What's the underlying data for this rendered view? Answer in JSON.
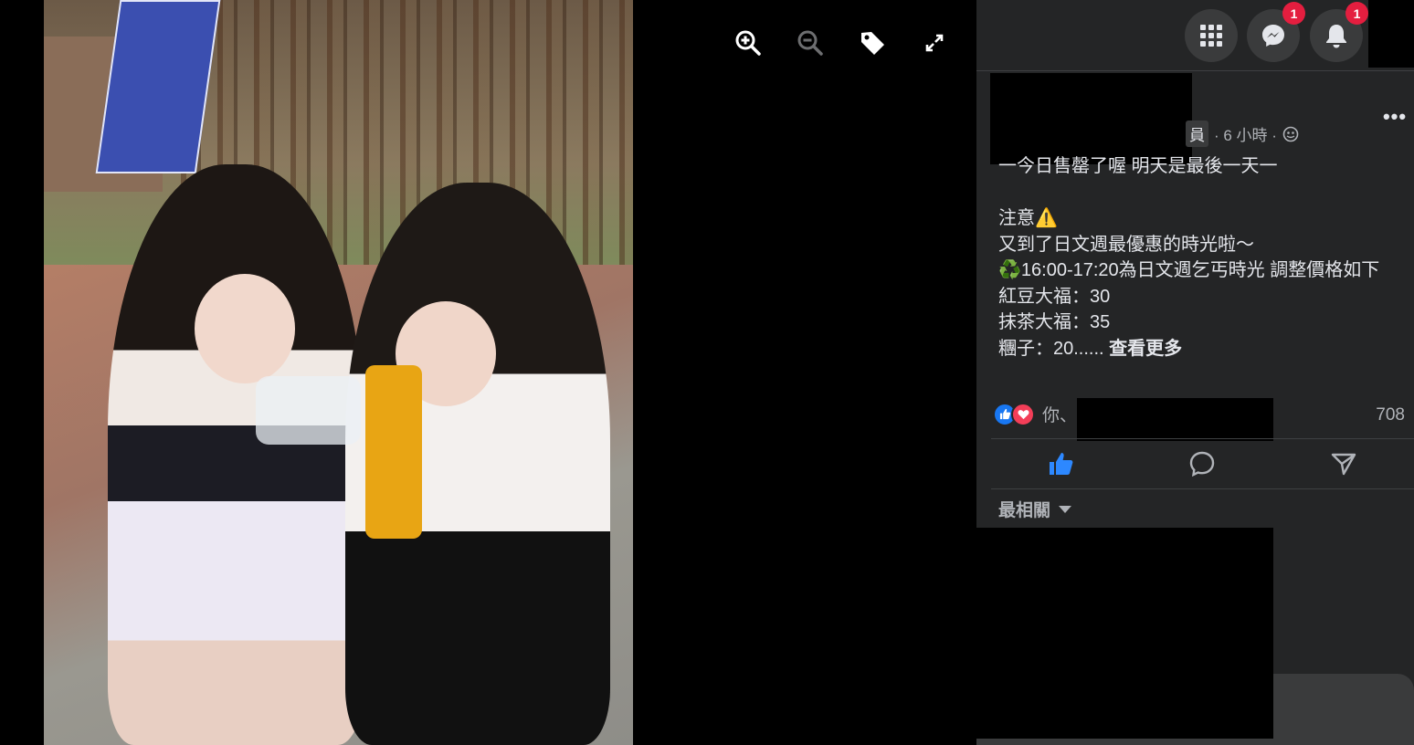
{
  "viewer": {
    "tools": [
      {
        "name": "zoom-in-icon"
      },
      {
        "name": "zoom-out-icon"
      },
      {
        "name": "tag-icon"
      },
      {
        "name": "fullscreen-icon"
      }
    ]
  },
  "topbar": {
    "messenger_badge": "1",
    "notifications_badge": "1"
  },
  "post": {
    "meta_cut": "員",
    "time": "· 6 小時 ·",
    "lines": [
      "一今日售罄了喔 明天是最後一天一",
      "",
      "注意⚠️",
      "又到了日文週最優惠的時光啦～",
      "♻️16:00-17:20為日文週乞丐時光 調整價格如下",
      "紅豆大福：30",
      "抹茶大福：35",
      "糰子：20......"
    ],
    "see_more": "查看更多"
  },
  "reactions": {
    "you_label": "你、",
    "count": "708"
  },
  "sort_label": "最相關",
  "colors": {
    "accent": "#1877f2",
    "love": "#f33e58",
    "badge": "#e41e3f"
  }
}
